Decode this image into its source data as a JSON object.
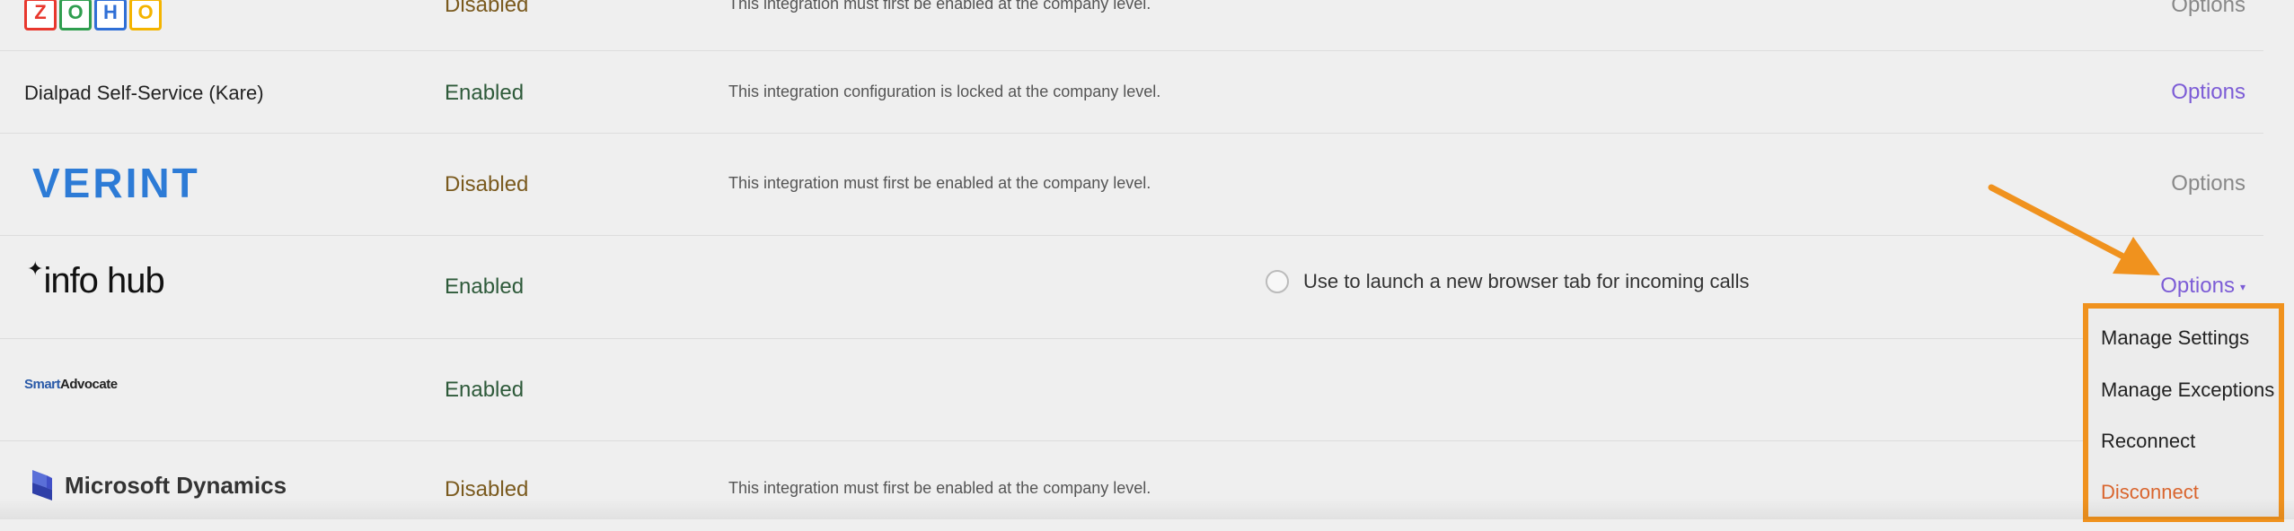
{
  "rows": [
    {
      "name": "Zoho",
      "logo_letters": [
        "Z",
        "O",
        "H",
        "O"
      ],
      "logo_colors": [
        "#e8372d",
        "#2f9e4f",
        "#2f6fd6",
        "#f4b400"
      ],
      "status": "Disabled",
      "description": "This integration must first be enabled at the company level.",
      "options": "Options"
    },
    {
      "name": "Dialpad Self-Service (Kare)",
      "status": "Enabled",
      "description": "This integration configuration is locked at the company level.",
      "options": "Options"
    },
    {
      "name": "VERINT",
      "status": "Disabled",
      "description": "This integration must first be enabled at the company level.",
      "options": "Options"
    },
    {
      "name": "info hub",
      "logo_star": "✦",
      "status": "Enabled",
      "radio_label": "Use to launch a new browser tab for incoming calls",
      "options": "Options",
      "options_caret": "▾"
    },
    {
      "name_part1": "Smart",
      "name_part2": "Advocate",
      "status": "Enabled"
    },
    {
      "name": "Microsoft Dynamics",
      "status": "Disabled",
      "description": "This integration must first be enabled at the company level."
    }
  ],
  "dropdown": {
    "items": [
      "Manage Settings",
      "Manage Exceptions",
      "Reconnect",
      "Disconnect"
    ]
  },
  "colors": {
    "accent": "#7c5cd6",
    "highlight": "#f0921e",
    "danger": "#d9652e",
    "verint": "#2d7bd6"
  }
}
